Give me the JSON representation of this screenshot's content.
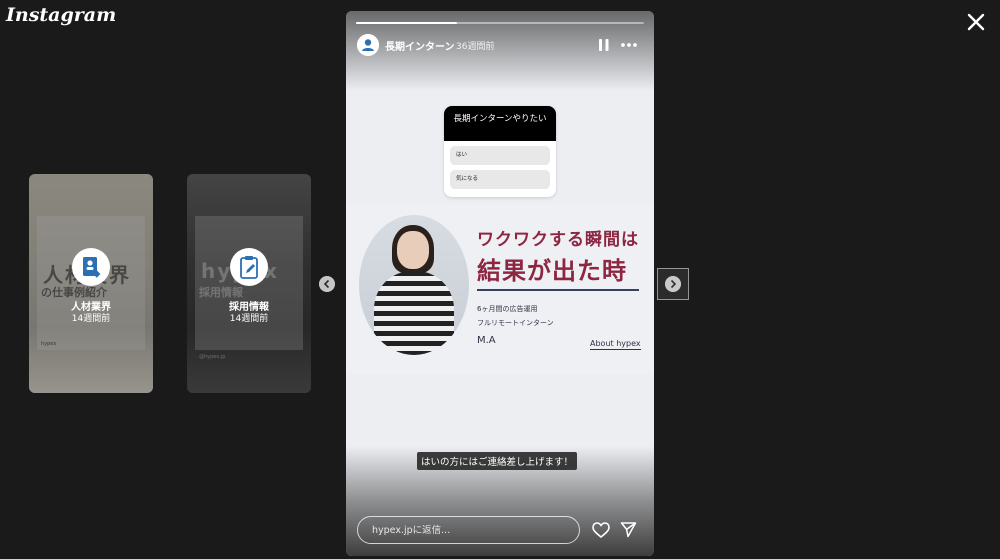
{
  "app": {
    "logo": "Instagram"
  },
  "previews": [
    {
      "name": "人材業界",
      "time": "14週間前",
      "art_title": "人材業界",
      "art_subtitle": "の仕事例紹介",
      "footer": "hypex",
      "icon": "document-person-icon"
    },
    {
      "name": "採用情報",
      "time": "14週間前",
      "art_title": "hypex",
      "art_subtitle": "採用情報",
      "footer": "@hypex.jp",
      "icon": "clipboard-edit-icon"
    }
  ],
  "story": {
    "username": "長期インターン",
    "time": "36週間前",
    "progress": 0.35,
    "poll": {
      "question": "長期インターンやりたい",
      "options": [
        "はい",
        "気になる"
      ]
    },
    "promo": {
      "headline1": "ワクワクする瞬間は",
      "headline2": "結果が出た時",
      "sub1": "6ヶ月間の広告運用",
      "sub2": "フルリモートインターン",
      "name": "M.A",
      "about": "About hypex"
    },
    "caption": "はいの方にはご連絡差し上げます！",
    "reply_placeholder": "hypex.jpに返信..."
  }
}
